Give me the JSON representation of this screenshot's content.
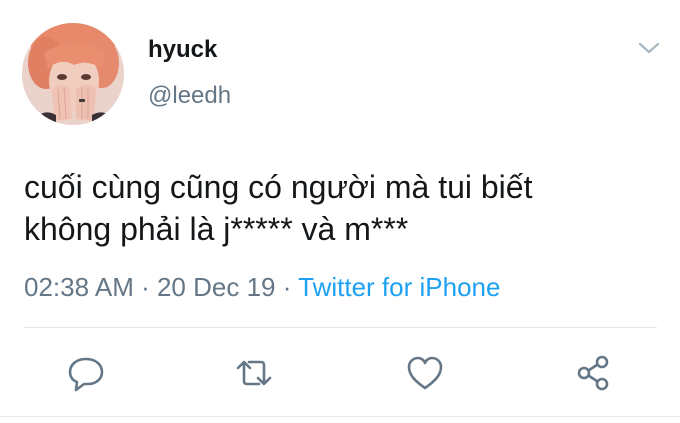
{
  "user": {
    "display_name": "hyuck",
    "handle": "@leedh",
    "avatar_icon": "profile-avatar"
  },
  "tweet": {
    "lines": [
      "cuối cùng cũng có người mà tui biết",
      "không phải là j***** và m***"
    ],
    "time": "02:38 AM",
    "separator": " · ",
    "date": "20 Dec 19",
    "separator2": " · ",
    "source": "Twitter for iPhone"
  },
  "actions": [
    {
      "icon": "reply-icon"
    },
    {
      "icon": "retweet-icon"
    },
    {
      "icon": "like-icon"
    },
    {
      "icon": "share-icon"
    }
  ],
  "colors": {
    "text": "#14171a",
    "secondary": "#657786",
    "link": "#1da1f2",
    "divider": "#e1e8ed"
  }
}
